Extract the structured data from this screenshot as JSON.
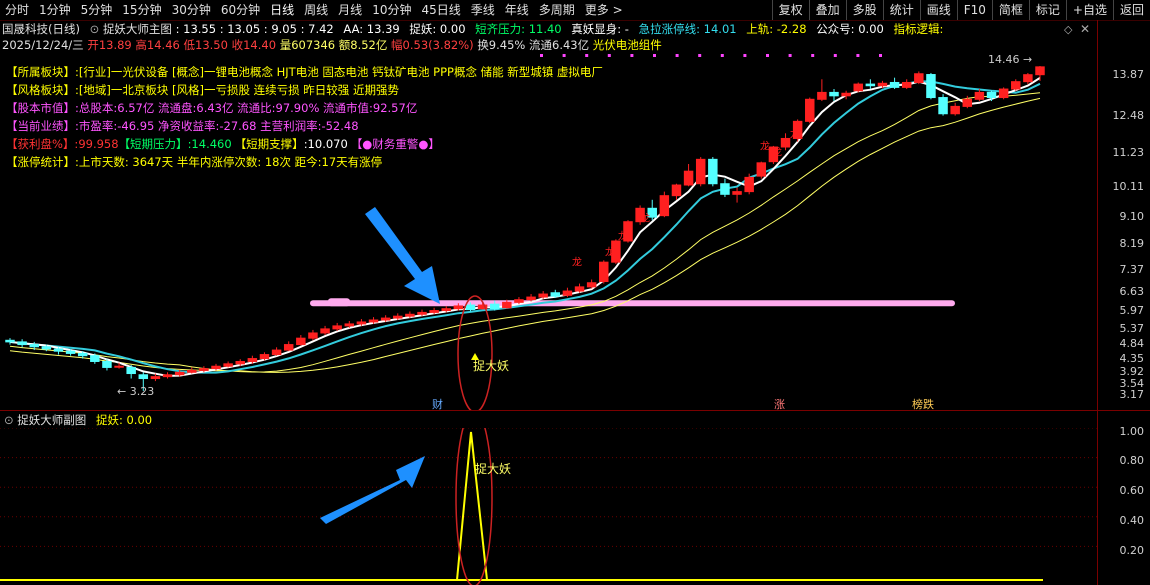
{
  "toolbar": {
    "periods": [
      "分时",
      "1分钟",
      "5分钟",
      "15分钟",
      "30分钟",
      "60分钟",
      "日线",
      "周线",
      "月线",
      "10分钟",
      "45日线",
      "季线",
      "年线",
      "多周期",
      "更多 >"
    ],
    "active_period": "日线",
    "right_buttons": [
      "复权",
      "叠加",
      "多股",
      "统计",
      "画线",
      "F10",
      "简框",
      "标记",
      "+自选",
      "返回"
    ]
  },
  "main_header": {
    "stock_title": "国晟科技(日线)",
    "indicator_name": "捉妖大师主图",
    "params": ": 13.55 : 13.05 : 9.05 : 7.42",
    "aa": "AA: 13.39",
    "zhuoyao": "捉妖: 0.00",
    "short_pressure": "短齐压力: 11.40",
    "zhenyao": "真妖显身: -",
    "jila": "急拉涨停线: 14.01",
    "upper_rail": "上轨: -2.28",
    "gonggong": "公众号: 0.00",
    "indicator_logic": "指标逻辑:"
  },
  "quote": {
    "date": "2025/12/24/三",
    "open": "开13.89",
    "high": "高14.46",
    "low": "低13.50",
    "close": "收14.40",
    "volume": "量607346",
    "amount": "额8.52亿",
    "change": "幅0.53(3.82%)",
    "turnover": "换9.45%",
    "float": "流通6.43亿",
    "concept": "光伏电池组件"
  },
  "info_panel": [
    {
      "label": "【所属板块】:",
      "text": "[行业]一光伏设备 [概念]一锂电池概念 HJT电池 固态电池 钙钛矿电池 PPP概念 储能 新型城镇 虚拟电厂",
      "color": "#ffff00"
    },
    {
      "label": "【风格板块】:",
      "text": "[地域]一北京板块 [风格]一亏损股 连续亏损 昨日较强 近期强势",
      "color": "#ffff00"
    },
    {
      "label": "【股本市值】:",
      "text": "总股本:6.57亿 流通盘:6.43亿 流通比:97.90% 流通市值:92.57亿",
      "color": "#ff55ff"
    },
    {
      "label": "【当前业绩】:",
      "text": "市盈率:-46.95 净资收益率:-27.68 主营利润率:-52.48",
      "color": "#ff55ff"
    },
    {
      "label": "【获利盘%】:",
      "text": "99.958",
      "color": "#ff3333"
    },
    {
      "label": "【涨停统计】:",
      "text": "上市天数: 3647天 半年内涨停次数: 18次 距今:17天有涨停",
      "color": "#ffff00"
    }
  ],
  "profit_row": {
    "short_pressure_label": "【短期压力】",
    "short_pressure_value": ":14.460",
    "short_support_label": "【短期支撑】",
    "short_support_value": ":10.070",
    "warning": "【●财务重警●】"
  },
  "y_axis_main": [
    "13.87",
    "12.48",
    "11.23",
    "10.11",
    "9.10",
    "8.19",
    "7.37",
    "6.63",
    "5.97",
    "5.37",
    "4.84",
    "4.35",
    "3.92",
    "3.54",
    "3.17"
  ],
  "y_axis_sub": [
    "1.00",
    "0.80",
    "0.60",
    "0.40",
    "0.20"
  ],
  "annotations": {
    "low_mark": "3.23",
    "high_mark": "14.46",
    "zhuo_da_yao_main": "捉大妖",
    "zhuo_da_yao_sub": "捉大妖",
    "dragon_glyph": "龙",
    "bottom_markers": [
      "财",
      "涨",
      "榜跌"
    ]
  },
  "sub_header": {
    "indicator_name": "捉妖大师副图",
    "value": "捉妖: 0.00"
  },
  "colors": {
    "up": "#ff2020",
    "down": "#54ffff",
    "ma_white": "#ffffff",
    "ma_cyan": "#33ccdd",
    "ma_yellow": "#ffff66",
    "pink_band": "#ffaaee",
    "axis_red": "#7a0000",
    "arrow_blue": "#1e90ff"
  }
}
